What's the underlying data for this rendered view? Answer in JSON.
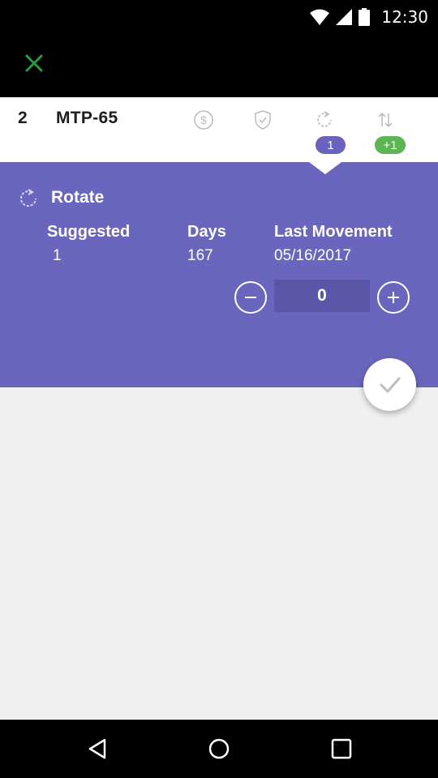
{
  "status_bar": {
    "time": "12:30"
  },
  "item": {
    "index": "2",
    "code": "MTP-65",
    "badges": {
      "rotate": "1",
      "transfer": "+1"
    }
  },
  "panel": {
    "title": "Rotate",
    "columns": [
      {
        "label": "Suggested",
        "value": "1"
      },
      {
        "label": "Days",
        "value": "167"
      },
      {
        "label": "Last Movement",
        "value": "05/16/2017"
      }
    ],
    "quantity": "0"
  },
  "colors": {
    "panel": "#6b66bd",
    "rotate_badge": "#6a63bd",
    "transfer_badge": "#5ab552",
    "close_icon": "#2e9c3a"
  },
  "icons": {
    "close": "close-icon",
    "dollar": "dollar-icon",
    "shield": "shield-check-icon",
    "rotate": "rotate-icon",
    "transfer": "transfer-arrows-icon",
    "minus": "minus-icon",
    "plus": "plus-icon",
    "confirm": "check-icon"
  }
}
